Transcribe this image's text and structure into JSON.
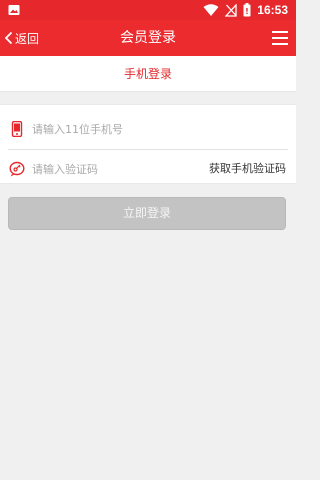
{
  "status_bar": {
    "time": "16:53",
    "icons": [
      "image-icon",
      "wifi-icon",
      "no-sim-icon",
      "battery-icon"
    ]
  },
  "header": {
    "back_label": "返回",
    "title": "会员登录",
    "menu_icon": "hamburger-menu-icon"
  },
  "tabs": {
    "active_label": "手机登录"
  },
  "form": {
    "phone_placeholder": "请输入11位手机号",
    "phone_value": "",
    "code_placeholder": "请输入验证码",
    "code_value": "",
    "get_code_label": "获取手机验证码"
  },
  "login_button": {
    "label": "立即登录"
  },
  "colors": {
    "brand_red": "#ec2b2f",
    "tab_text": "#e6282c",
    "disabled_button": "#c3c3c3",
    "background": "#f0f0f0"
  }
}
